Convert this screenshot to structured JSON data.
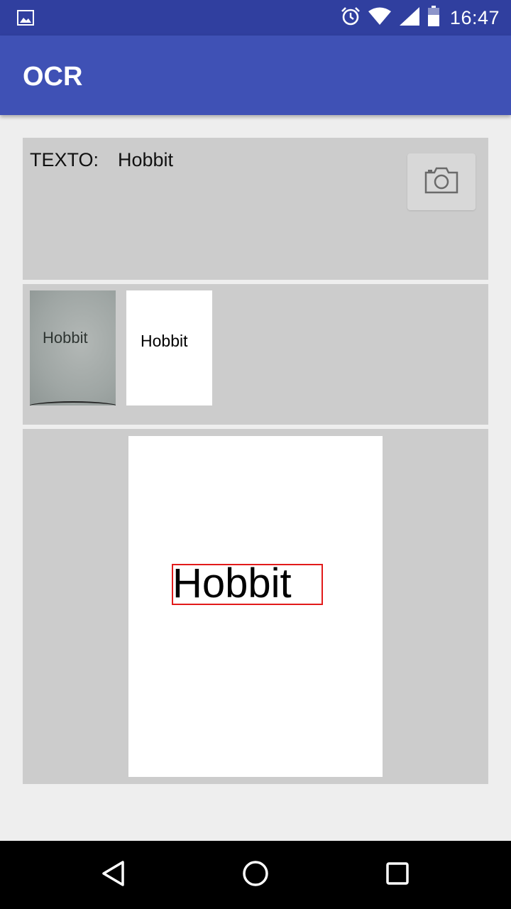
{
  "status_bar": {
    "left_icon": "image-icon",
    "icons": [
      "alarm-icon",
      "wifi-icon",
      "signal-icon",
      "battery-icon"
    ],
    "time": "16:47"
  },
  "app_bar": {
    "title": "OCR"
  },
  "result_panel": {
    "label": "TEXTO:",
    "value": "Hobbit",
    "camera_button_icon": "camera-icon"
  },
  "thumbnails": {
    "photo_text": "Hobbit",
    "binary_text": "Hobbit"
  },
  "detection": {
    "word": "Hobbit",
    "bbox_color": "#e21a1a"
  },
  "colors": {
    "status_bar": "#303f9f",
    "app_bar": "#3f51b5",
    "panel": "#cccccc",
    "background": "#eeeeee"
  },
  "nav_bar": {
    "icons": [
      "back-icon",
      "home-icon",
      "recents-icon"
    ]
  }
}
